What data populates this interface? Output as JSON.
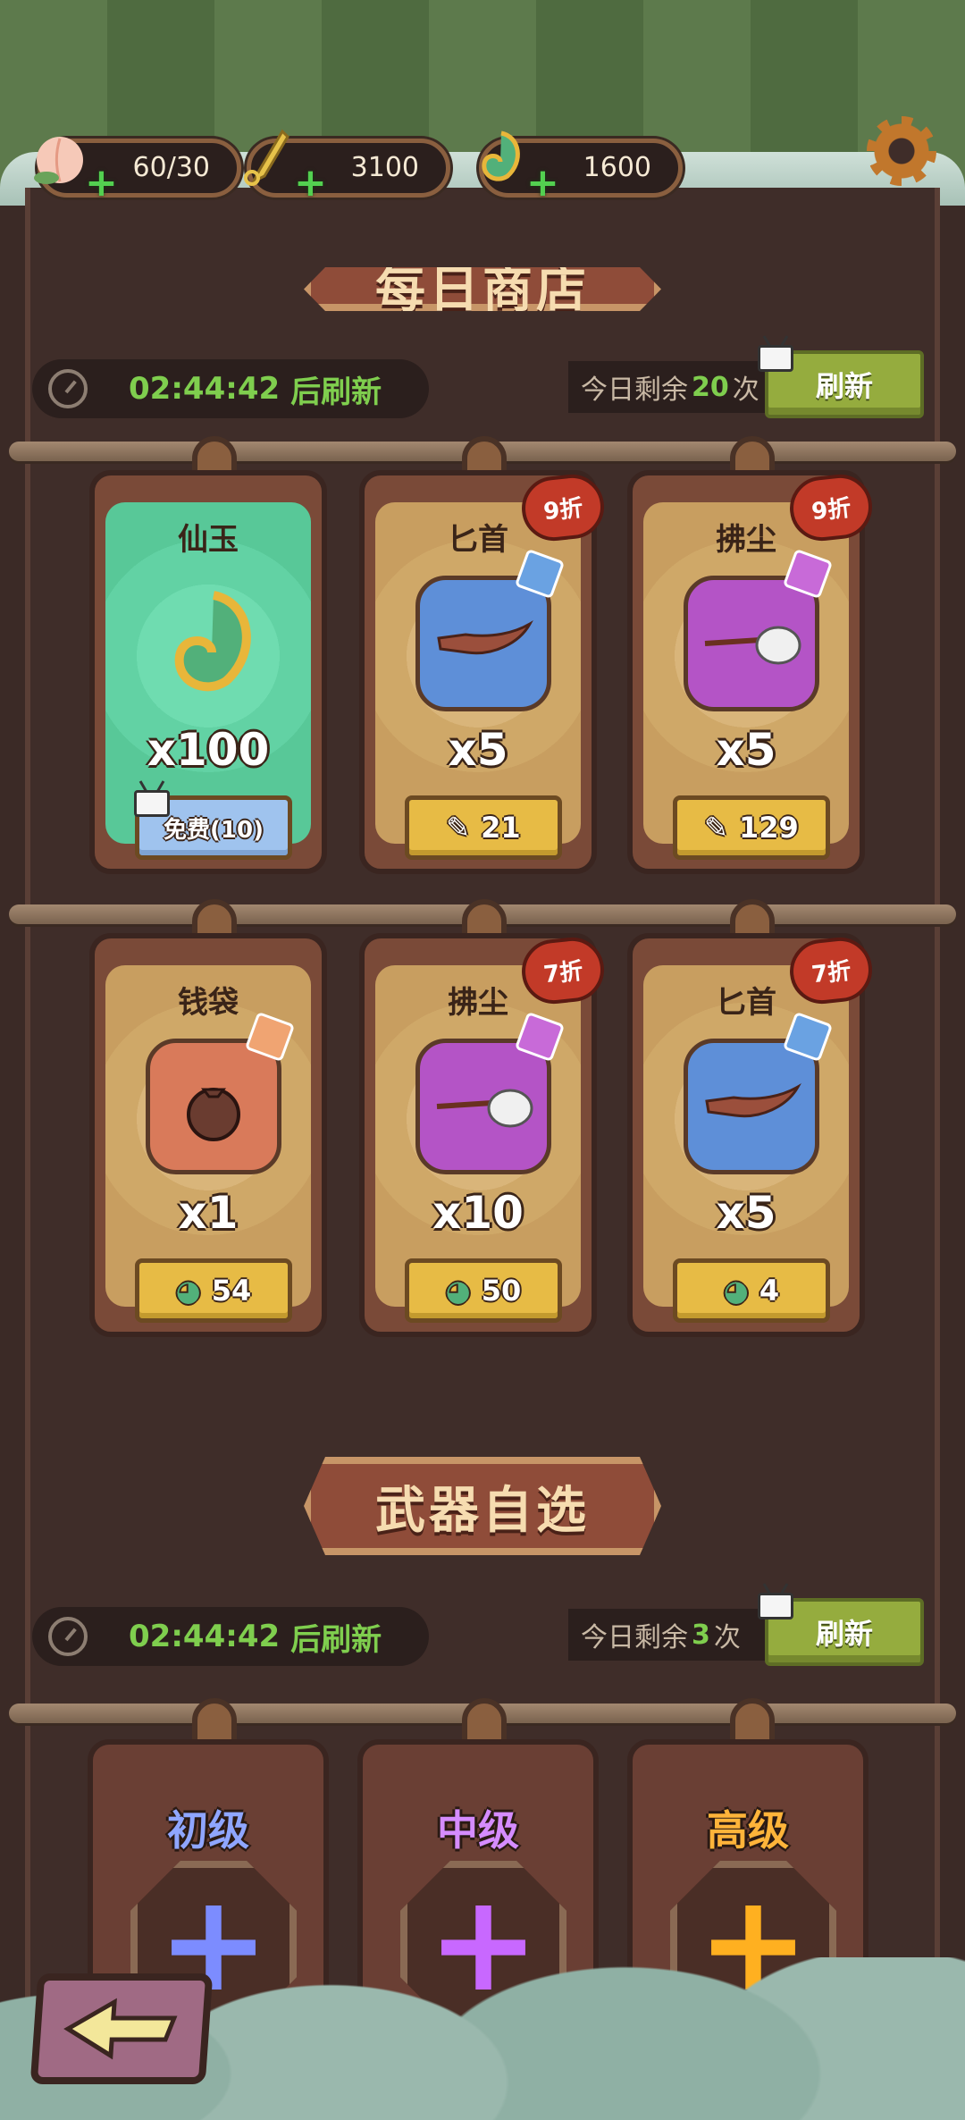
{
  "resources": [
    {
      "name": "peach",
      "value": "60/30"
    },
    {
      "name": "gourd-scroll",
      "value": "3100"
    },
    {
      "name": "jade",
      "value": "1600"
    }
  ],
  "shop1": {
    "banner": "每日商店",
    "timer": "02:44:42",
    "timer_suffix": "后刷新",
    "remain_prefix": "今日剩余",
    "remain_count": "20",
    "remain_suffix": "次",
    "refresh_label": "刷新",
    "items": [
      {
        "title": "仙玉",
        "qty": "x100",
        "price": "免费(10)",
        "discount": ""
      },
      {
        "title": "匕首",
        "qty": "x5",
        "price": "21",
        "discount": "9折"
      },
      {
        "title": "拂尘",
        "qty": "x5",
        "price": "129",
        "discount": "9折"
      },
      {
        "title": "钱袋",
        "qty": "x1",
        "price": "54",
        "discount": ""
      },
      {
        "title": "拂尘",
        "qty": "x10",
        "price": "50",
        "discount": "7折"
      },
      {
        "title": "匕首",
        "qty": "x5",
        "price": "4",
        "discount": "7折"
      }
    ]
  },
  "shop2": {
    "banner": "武器自选",
    "timer": "02:44:42",
    "timer_suffix": "后刷新",
    "remain_prefix": "今日剩余",
    "remain_count": "3",
    "remain_suffix": "次",
    "refresh_label": "刷新",
    "tiers": [
      {
        "label": "初级",
        "color": "#8fa6ff"
      },
      {
        "label": "中级",
        "color": "#d58cff"
      },
      {
        "label": "高级",
        "color": "#ffb43a"
      }
    ]
  }
}
